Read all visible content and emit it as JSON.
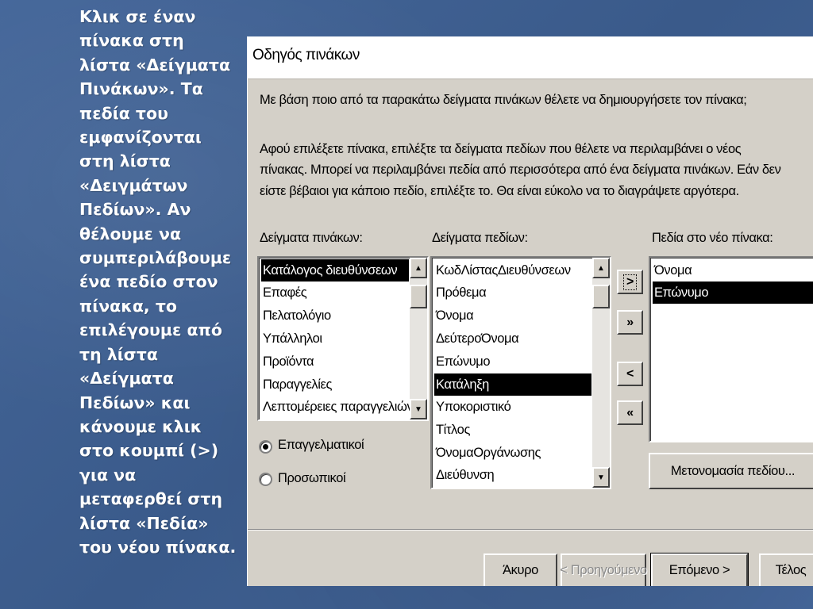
{
  "slide": {
    "text": "Κλικ σε έναν πίνακα στη λίστα «Δείγματα Πινάκων». Τα πεδία του εμφανίζονται στη λίστα «Δειγμάτων Πεδίων». Αν θέλουμε να συμπεριλάβουμε ένα πεδίο στον πίνακα, το επιλέγουμε από τη λίστα «Δείγματα Πεδίων» και κάνουμε κλικ στο κουμπί (>) για να μεταφερθεί στη λίστα «Πεδία» του νέου πίνακα."
  },
  "dialog": {
    "title": "Οδηγός πινάκων",
    "question": "Με βάση ποιο από τα παρακάτω δείγματα πινάκων θέλετε να δημιουργήσετε τον πίνακα;",
    "instructions": [
      "Αφού επιλέξετε πίνακα, επιλέξτε τα δείγματα πεδίων που θέλετε να περιλαμβάνει ο νέος",
      "πίνακας. Μπορεί να περιλαμβάνει πεδία από περισσότερα από ένα δείγματα πινάκων. Εάν δεν",
      "είστε βέβαιοι για κάποιο πεδίο, επιλέξτε το. Θα είναι εύκολο να το διαγράψετε αργότερα."
    ],
    "sample_tables_label": "Δείγματα πινάκων:",
    "sample_fields_label": "Δείγματα πεδίων:",
    "new_table_fields_label": "Πεδία στο νέο πίνακα:",
    "sample_tables": [
      "Κατάλογος διευθύνσεων",
      "Επαφές",
      "Πελατολόγιο",
      "Υπάλληλοι",
      "Προϊόντα",
      "Παραγγελίες",
      "Λεπτομέρειες παραγγελιών"
    ],
    "sample_tables_selected": 0,
    "sample_fields": [
      "ΚωδΛίσταςΔιευθύνσεων",
      "Πρόθεμα",
      "Όνομα",
      "ΔεύτεροΌνομα",
      "Επώνυμο",
      "Κατάληξη",
      "Υποκοριστικό",
      "Τίτλος",
      "ΌνομαΟργάνωσης",
      "Διεύθυνση"
    ],
    "sample_fields_selected": 5,
    "new_table_fields": [
      "Όνομα",
      "Επώνυμο"
    ],
    "new_table_fields_selected": 1,
    "move_buttons": {
      "add_one": ">",
      "add_all": "»",
      "remove_one": "<",
      "remove_all": "«"
    },
    "radio_business": "Επαγγελματικοί",
    "radio_personal": "Προσωπικοί",
    "radio_selected": "business",
    "rename_button": "Μετονομασία πεδίου...",
    "cancel_button": "Άκυρο",
    "back_button": "< Προηγούμενο",
    "next_button": "Επόμενο >",
    "finish_button": "Τέλος"
  }
}
